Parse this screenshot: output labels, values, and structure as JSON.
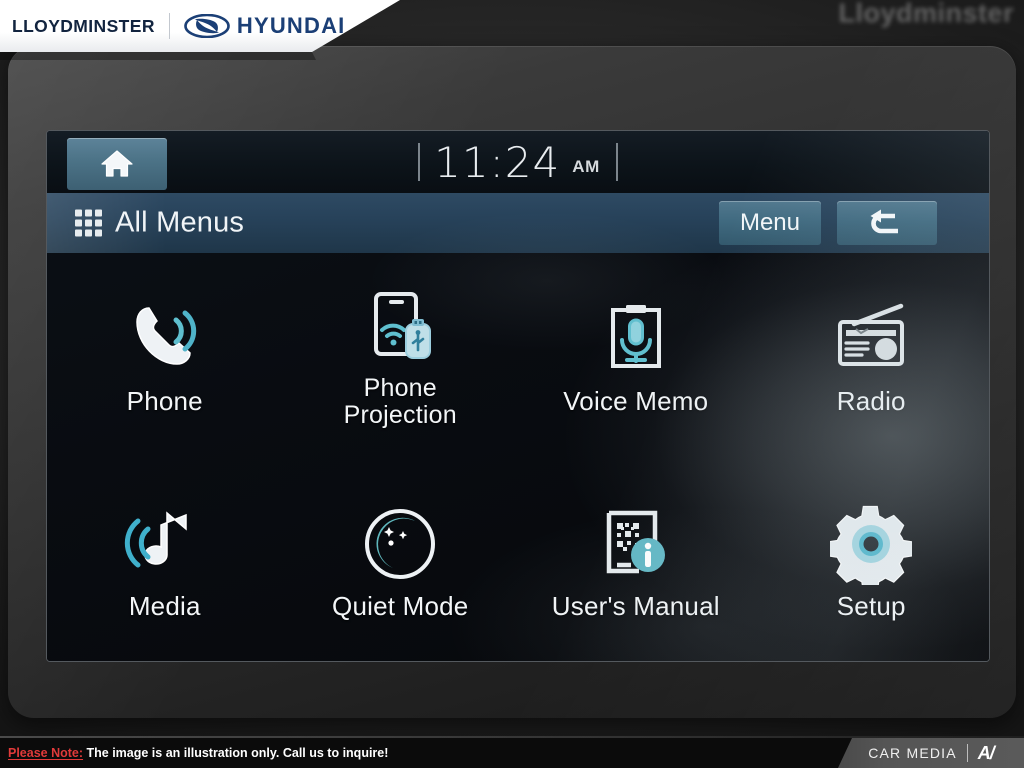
{
  "colors": {
    "accent_teal": "#6fc4cf",
    "accent_blue": "#3d9fd6",
    "header_blue": "#27425a",
    "button_blue": "#406a80",
    "icon_white": "#e9eef1",
    "screen_bg": "#07090c",
    "brand_navy": "#1b3f76",
    "note_red": "#e03a3a"
  },
  "dealer_banner": {
    "dealer_name": "LLOYDMINSTER",
    "brand_name": "HYUNDAI",
    "brand_logo_icon": "hyundai-h-ellipse-logo",
    "divider_icon": "vertical-divider"
  },
  "watermark": {
    "text": "Lloydminster"
  },
  "head_unit": {
    "status_bar": {
      "home_button": {
        "label": "Home",
        "icon": "home-icon"
      },
      "clock": {
        "time": "11:24",
        "meridiem": "AM",
        "left_separator_icon": "vertical-bar",
        "right_separator_icon": "vertical-bar"
      }
    },
    "title_bar": {
      "grid_icon": "apps-grid-icon",
      "title": "All Menus",
      "menu_button": {
        "label": "Menu"
      },
      "back_button": {
        "label": "Back",
        "icon": "back-arrow-icon"
      }
    },
    "menu_grid": {
      "rows": 2,
      "columns": 4,
      "items": [
        {
          "id": "phone",
          "label": "Phone",
          "icon": "phone-handset-waves-icon"
        },
        {
          "id": "phone-projection",
          "label": "Phone\nProjection",
          "label_line1": "Phone",
          "label_line2": "Projection",
          "icon": "phone-projection-wifi-usb-icon"
        },
        {
          "id": "voice-memo",
          "label": "Voice Memo",
          "icon": "clipboard-microphone-icon"
        },
        {
          "id": "radio",
          "label": "Radio",
          "icon": "radio-antenna-icon"
        },
        {
          "id": "media",
          "label": "Media",
          "icon": "music-note-waves-icon"
        },
        {
          "id": "quiet-mode",
          "label": "Quiet Mode",
          "icon": "crescent-moon-stars-icon"
        },
        {
          "id": "users-manual",
          "label": "User's Manual",
          "icon": "qr-code-info-icon"
        },
        {
          "id": "setup",
          "label": "Setup",
          "icon": "gear-icon"
        }
      ]
    }
  },
  "footer": {
    "note_lead": "Please Note:",
    "note_body": "The image is an illustration only. Call us to inquire!",
    "watermark_text": "CAR MEDIA",
    "watermark_mark": "A/",
    "watermark_divider_icon": "vertical-divider"
  }
}
